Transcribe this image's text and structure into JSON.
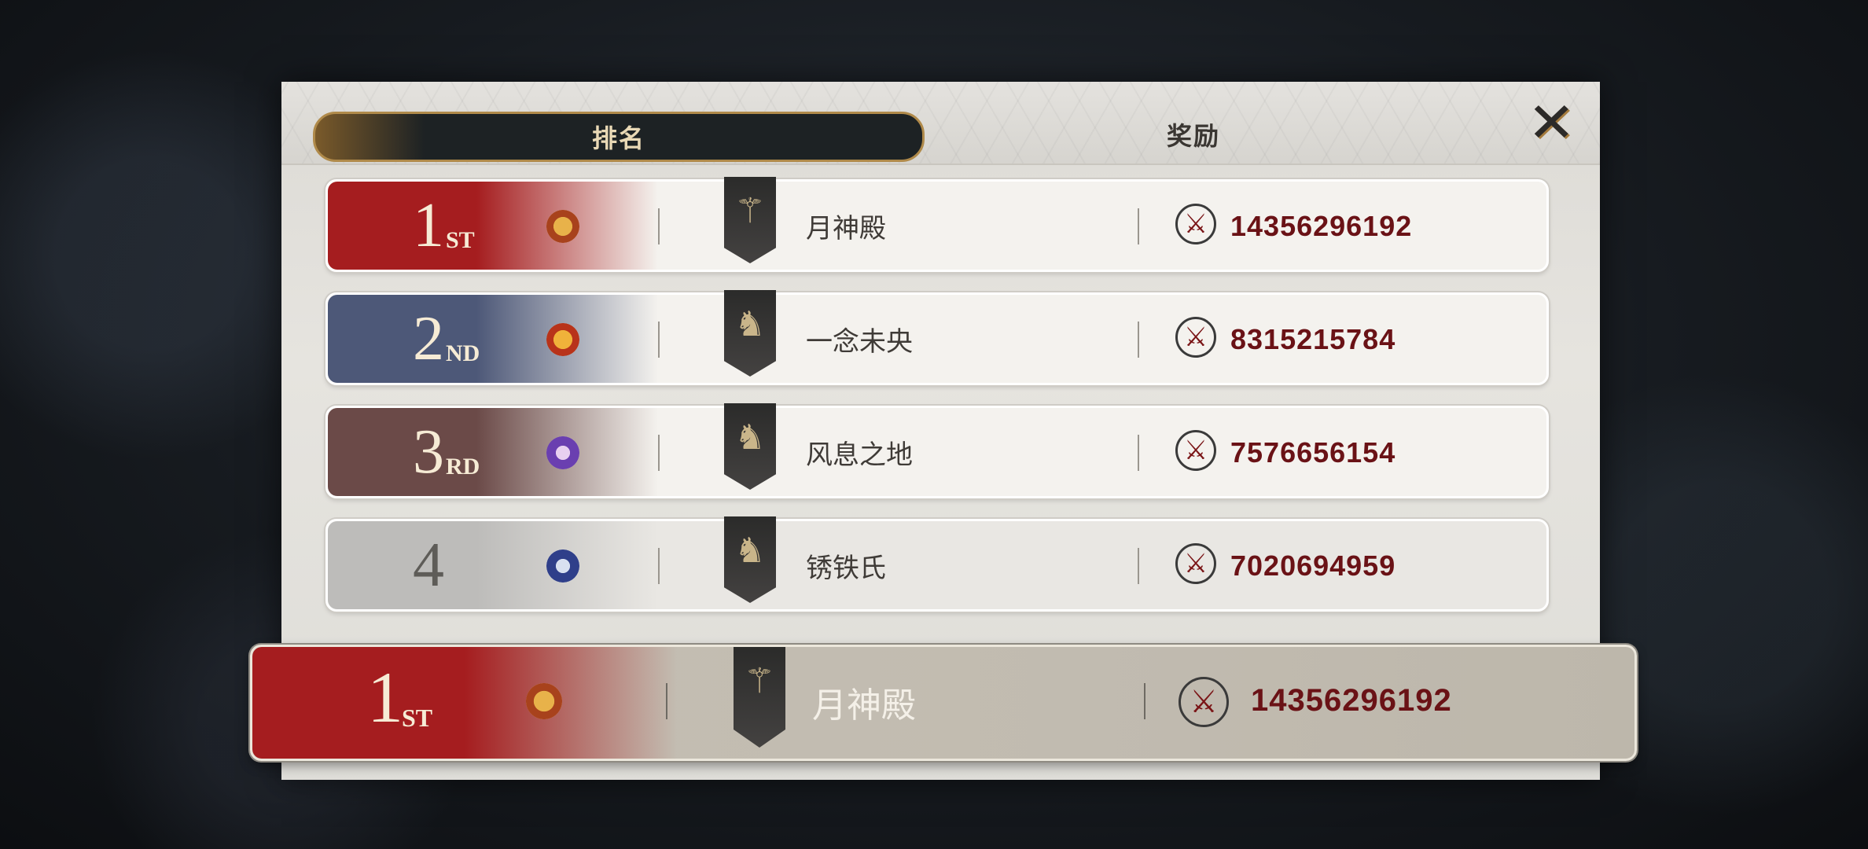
{
  "tabs": {
    "ranking": "排名",
    "rewards": "奖励"
  },
  "close_icon": "close-icon",
  "rows": [
    {
      "rank": "1",
      "suffix": "ST",
      "name": "月神殿",
      "score": "14356296192",
      "color": "#a51d1f"
    },
    {
      "rank": "2",
      "suffix": "ND",
      "name": "一念未央",
      "score": "8315215784",
      "color": "#4d5878"
    },
    {
      "rank": "3",
      "suffix": "RD",
      "name": "风息之地",
      "score": "7576656154",
      "color": "#6b4a48"
    },
    {
      "rank": "4",
      "suffix": "",
      "name": "锈铁氏",
      "score": "7020694959",
      "color": "#bdbcba"
    }
  ],
  "self": {
    "rank": "1",
    "suffix": "ST",
    "name": "月神殿",
    "score": "14356296192",
    "color": "#a51d1f"
  }
}
